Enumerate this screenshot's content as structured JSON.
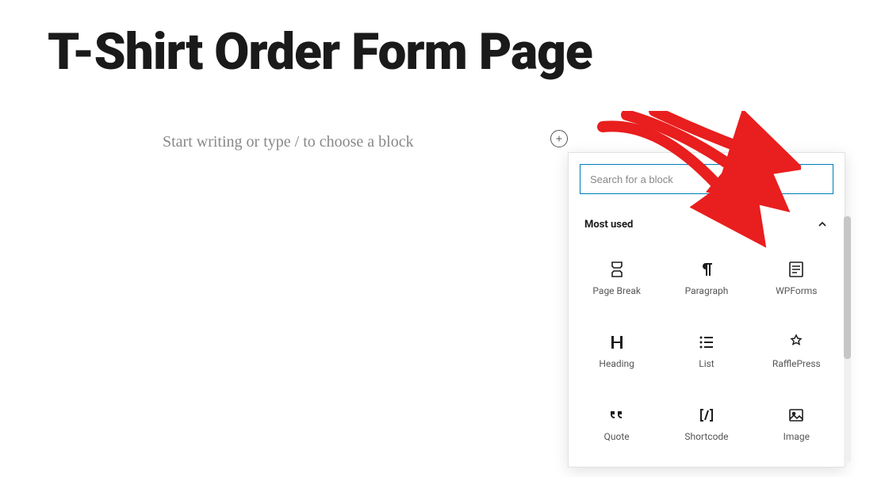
{
  "page": {
    "title": "T-Shirt Order Form Page",
    "placeholder": "Start writing or type / to choose a block"
  },
  "inserter": {
    "search_placeholder": "Search for a block",
    "section_title": "Most used",
    "blocks": [
      {
        "name": "page-break",
        "label": "Page Break"
      },
      {
        "name": "paragraph",
        "label": "Paragraph"
      },
      {
        "name": "wpforms",
        "label": "WPForms"
      },
      {
        "name": "heading",
        "label": "Heading"
      },
      {
        "name": "list",
        "label": "List"
      },
      {
        "name": "rafflepress",
        "label": "RafflePress"
      },
      {
        "name": "quote",
        "label": "Quote"
      },
      {
        "name": "shortcode",
        "label": "Shortcode"
      },
      {
        "name": "image",
        "label": "Image"
      }
    ]
  },
  "annotation": {
    "arrow_color": "#e91e1e"
  }
}
